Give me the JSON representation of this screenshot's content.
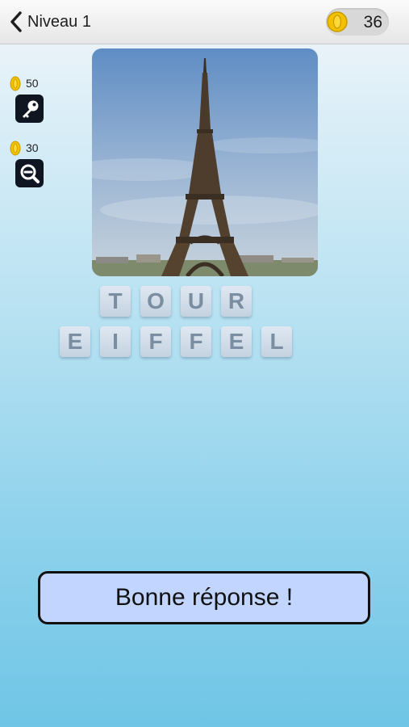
{
  "header": {
    "back_label": "Niveau 1",
    "coin_count": "36",
    "icons": {
      "back": "chevron-left-icon",
      "coin": "coin-icon"
    }
  },
  "hints": [
    {
      "cost": "50",
      "icon": "key-icon"
    },
    {
      "cost": "30",
      "icon": "zoom-out-icon"
    }
  ],
  "puzzle": {
    "image": "eiffel-tower-photo",
    "words": [
      [
        "T",
        "O",
        "U",
        "R"
      ],
      [
        "E",
        "I",
        "F",
        "F",
        "E",
        "L"
      ]
    ]
  },
  "result": {
    "message": "Bonne réponse !"
  },
  "colors": {
    "coin": "#f2c200",
    "hint_button": "#0f1621",
    "tile_text": "#7b8da0",
    "answer_box": "#c1d5ff"
  }
}
